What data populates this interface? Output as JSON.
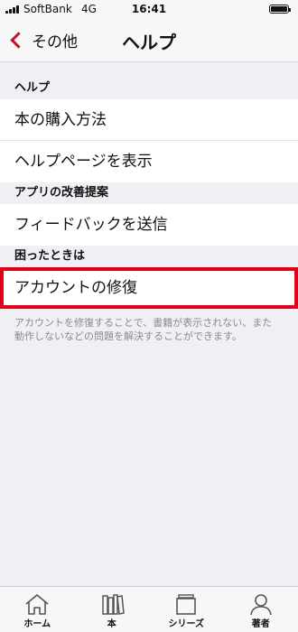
{
  "status_bar": {
    "carrier": "SoftBank",
    "network": "4G",
    "time": "16:41"
  },
  "nav_bar": {
    "back_label": "その他",
    "title": "ヘルプ"
  },
  "sections": [
    {
      "header": "ヘルプ",
      "rows": [
        "本の購入方法",
        "ヘルプページを表示"
      ]
    },
    {
      "header": "アプリの改善提案",
      "rows": [
        "フィードバックを送信"
      ]
    },
    {
      "header": "困ったときは",
      "rows": [
        "アカウントの修復"
      ]
    }
  ],
  "footer_note": {
    "line1": "アカウントを修復することで、書籍が表示されない、また",
    "line2": "動作しないなどの問題を解決することができます。"
  },
  "highlight_color": "#e00018",
  "accent_color": "#c8102e",
  "tab_bar": {
    "items": [
      {
        "label": "ホーム",
        "icon": "home-icon"
      },
      {
        "label": "本",
        "icon": "bookshelf-icon"
      },
      {
        "label": "シリーズ",
        "icon": "series-stack-icon"
      },
      {
        "label": "著者",
        "icon": "person-icon"
      }
    ]
  }
}
